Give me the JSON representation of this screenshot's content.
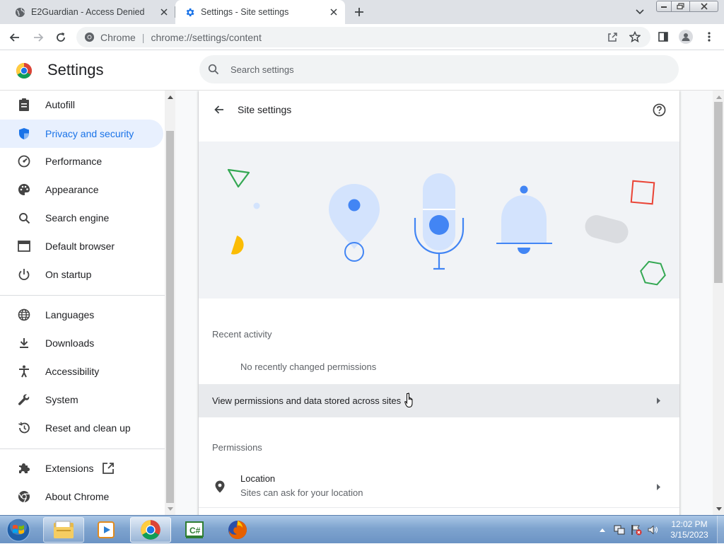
{
  "tabs": [
    {
      "title": "E2Guardian - Access Denied",
      "icon": "globe-icon"
    },
    {
      "title": "Settings - Site settings",
      "icon": "gear-icon"
    }
  ],
  "omnibox": {
    "chip": "Chrome",
    "url": "chrome://settings/content"
  },
  "settings": {
    "title": "Settings",
    "search_placeholder": "Search settings"
  },
  "sidebar": {
    "items": [
      {
        "label": "Autofill",
        "icon": "clipboard-icon",
        "active": false
      },
      {
        "label": "Privacy and security",
        "icon": "shield-icon",
        "active": true
      },
      {
        "label": "Performance",
        "icon": "speedometer-icon",
        "active": false
      },
      {
        "label": "Appearance",
        "icon": "palette-icon",
        "active": false
      },
      {
        "label": "Search engine",
        "icon": "search-icon",
        "active": false
      },
      {
        "label": "Default browser",
        "icon": "browser-window-icon",
        "active": false
      },
      {
        "label": "On startup",
        "icon": "power-icon",
        "active": false
      },
      {
        "label": "Languages",
        "icon": "globe-icon",
        "active": false
      },
      {
        "label": "Downloads",
        "icon": "download-icon",
        "active": false
      },
      {
        "label": "Accessibility",
        "icon": "accessibility-icon",
        "active": false
      },
      {
        "label": "System",
        "icon": "wrench-icon",
        "active": false
      },
      {
        "label": "Reset and clean up",
        "icon": "history-icon",
        "active": false
      },
      {
        "label": "Extensions",
        "icon": "puzzle-icon",
        "active": false
      },
      {
        "label": "About Chrome",
        "icon": "chrome-icon",
        "active": false
      }
    ]
  },
  "site_settings": {
    "title": "Site settings",
    "recent_activity": {
      "heading": "Recent activity",
      "empty": "No recently changed permissions"
    },
    "view_all": "View permissions and data stored across sites",
    "permissions": {
      "heading": "Permissions",
      "location": {
        "label": "Location",
        "description": "Sites can ask for your location"
      }
    }
  },
  "taskbar": {
    "apps": [
      "file-explorer-icon",
      "media-player-icon",
      "chrome-icon",
      "csharp-icon",
      "firefox-icon"
    ],
    "time": "12:02 PM",
    "date": "3/15/2023"
  },
  "colors": {
    "accent": "#1a73e8",
    "active_bg": "#e8f0fe",
    "illustration_blue": "#d3e3fd"
  }
}
